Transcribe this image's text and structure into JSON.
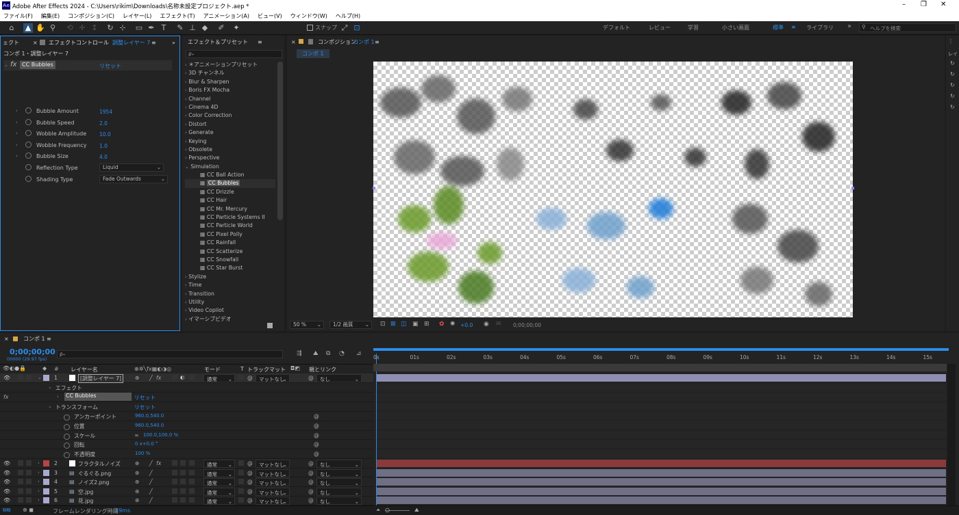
{
  "window": {
    "title": "Adobe After Effects 2024 - C:\\Users\\rikim\\Downloads\\名称未設定プロジェクト.aep *",
    "app_icon": "Ae",
    "controls": [
      "–",
      "❐",
      "✕"
    ]
  },
  "menu": [
    "ファイル(F)",
    "編集(E)",
    "コンポジション(C)",
    "レイヤー(L)",
    "エフェクト(T)",
    "アニメーション(A)",
    "ビュー(V)",
    "ウィンドウ(W)",
    "ヘルプ(H)"
  ],
  "toolbar": {
    "snap_label": "スナップ",
    "workspaces": [
      "デフォルト",
      "レビュー",
      "学習",
      "小さい画面",
      "標準",
      "ライブラリ"
    ],
    "active_workspace": "標準",
    "help_placeholder": "ヘルプを検索"
  },
  "effect_controls": {
    "tab_left": "ェクト",
    "tab_label": "エフェクトコントロール",
    "tab_layer": "調整レイヤー 7",
    "breadcrumb": "コンポ 1・調整レイヤー 7",
    "effect_name": "CC Bubbles",
    "reset": "リセット",
    "params": [
      {
        "name": "Bubble Amount",
        "value": "1954"
      },
      {
        "name": "Bubble Speed",
        "value": "2.0"
      },
      {
        "name": "Wobble Amplitude",
        "value": "10.0"
      },
      {
        "name": "Wobble Frequency",
        "value": "1.0"
      },
      {
        "name": "Bubble Size",
        "value": "4.0"
      }
    ],
    "dropdowns": [
      {
        "name": "Reflection Type",
        "value": "Liquid"
      },
      {
        "name": "Shading Type",
        "value": "Fade Outwards"
      }
    ]
  },
  "effects_presets": {
    "title": "エフェクト＆プリセット",
    "search_placeholder": "ρ₊",
    "categories": [
      "＊アニメーションプリセット",
      "3D チャンネル",
      "Blur & Sharpen",
      "Boris FX Mocha",
      "Channel",
      "Cinema 4D",
      "Color Correction",
      "Distort",
      "Generate",
      "Keying",
      "Obsolete",
      "Perspective",
      "Simulation"
    ],
    "simulation_items": [
      "CC Ball Action",
      "CC Bubbles",
      "CC Drizzle",
      "CC Hair",
      "CC Mr. Mercury",
      "CC Particle Systems II",
      "CC Particle World",
      "CC Pixel Polly",
      "CC Rainfall",
      "CC Scatterize",
      "CC Snowfall",
      "CC Star Burst"
    ],
    "selected_item": "CC Bubbles",
    "categories_after": [
      "Stylize",
      "Time",
      "Transition",
      "Utility",
      "Video Copilot",
      "イマーシブビデオ"
    ]
  },
  "composition": {
    "panel_title": "コンポジション",
    "comp_name": "コンポ 1",
    "tab": "コンポ 1",
    "zoom": "50 %",
    "resolution": "1/2 画質",
    "exposure": "+0.0",
    "timecode": "0;00;00;00"
  },
  "timeline": {
    "tab": "コンポ 1",
    "timecode": "0;00;00;00",
    "fps": "00000 (29.97 fps)",
    "search_placeholder": "ρ₊",
    "col_headers": {
      "num": "#",
      "name": "レイヤー名",
      "mode": "モード",
      "t": "T",
      "trackmatte": "トラックマット",
      "parent": "親とリンク"
    },
    "ruler": [
      "0s",
      "01s",
      "02s",
      "03s",
      "04s",
      "05s",
      "06s",
      "07s",
      "08s",
      "09s",
      "10s",
      "11s",
      "12s",
      "13s",
      "14s",
      "15s"
    ],
    "effect_group": "エフェクト",
    "effect_item": "CC Bubbles",
    "transform_group": "トランスフォーム",
    "reset": "リセット",
    "transform": [
      {
        "name": "アンカーポイント",
        "value": "960.0,540.0"
      },
      {
        "name": "位置",
        "value": "960.0,540.0"
      },
      {
        "name": "スケール",
        "value": "100.0,100.0 %"
      },
      {
        "name": "回転",
        "value": "0 x+0.0 °"
      },
      {
        "name": "不透明度",
        "value": "100 %"
      }
    ],
    "layers": [
      {
        "num": "1",
        "name": "[調整レイヤー 7]",
        "mode": "通常",
        "matte": "マットなし",
        "parent": "なし",
        "color": "#a9a9cf",
        "bar": "#8f8fb4"
      },
      {
        "num": "2",
        "name": "フラクタルノイズ",
        "mode": "通常",
        "matte": "マットなし",
        "parent": "なし",
        "color": "#b94444",
        "bar": "#8a3a3a"
      },
      {
        "num": "3",
        "name": "ぐるぐる.png",
        "mode": "通常",
        "matte": "マットなし",
        "parent": "なし",
        "color": "#a9a9cf",
        "bar": "#6f6f86"
      },
      {
        "num": "4",
        "name": "ノイズ2.png",
        "mode": "通常",
        "matte": "マットなし",
        "parent": "なし",
        "color": "#a9a9cf",
        "bar": "#6f6f86"
      },
      {
        "num": "5",
        "name": "空.jpg",
        "mode": "通常",
        "matte": "マットなし",
        "parent": "なし",
        "color": "#a9a9cf",
        "bar": "#6f6f86"
      },
      {
        "num": "6",
        "name": "花.jpg",
        "mode": "通常",
        "matte": "マットなし",
        "parent": "なし",
        "color": "#a9a9cf",
        "bar": "#6f6f86"
      }
    ],
    "footer_label": "フレームレンダリング時間",
    "footer_value": "19ms"
  }
}
